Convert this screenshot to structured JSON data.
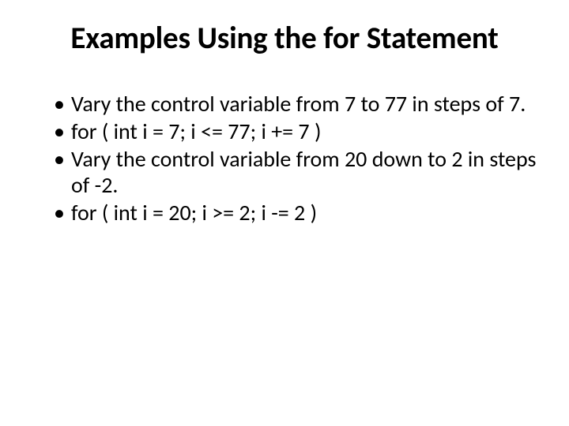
{
  "title": "Examples Using the for Statement",
  "bullets": [
    "Vary the control variable from 7 to 77 in steps of 7.",
    "for ( int i = 7; i <= 77; i += 7 )",
    "Vary the control variable from 20 down to 2 in steps of -2.",
    "for ( int i = 20; i >= 2; i -= 2 )"
  ]
}
